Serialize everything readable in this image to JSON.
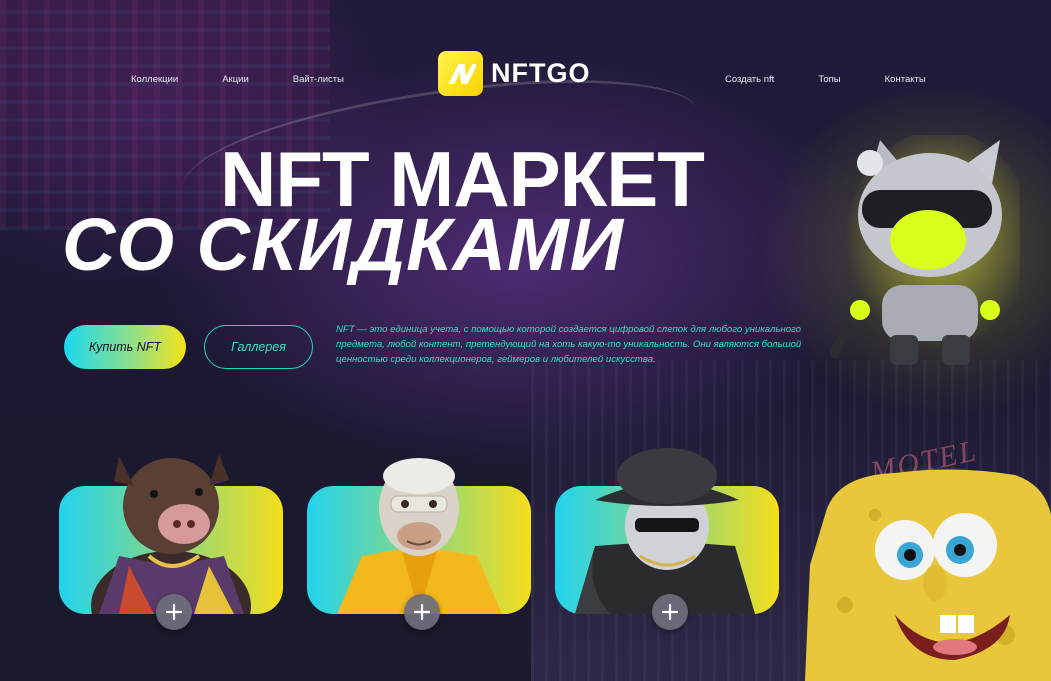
{
  "nav": {
    "left": [
      "Коллекции",
      "Акции",
      "Вайт-листы"
    ],
    "right": [
      "Создать nft",
      "Топы",
      "Контакты"
    ]
  },
  "logo": {
    "text": "NFTGO"
  },
  "hero": {
    "line1": "NFT МАРКЕТ",
    "line2": "СО СКИДКАМИ",
    "buy_label": "Купить NFT",
    "gallery_label": "Галлерея",
    "description": "NFT — это единица учета, с помощью которой создается цифровой слепок для любого уникального предмета, любой контент, претендующий на хоть какую-то уникальность. Они являются большой ценностью среди коллекционеров, геймеров и любителей искусства."
  },
  "decor": {
    "neon_sign": "MOTEL"
  },
  "cards": [
    {
      "art": "boar-character",
      "action": "add"
    },
    {
      "art": "ape-character",
      "action": "add"
    },
    {
      "art": "masked-bucket-hat-character",
      "action": "add"
    }
  ],
  "colors": {
    "accent_cyan": "#22d3ee",
    "accent_yellow": "#f5de1c",
    "accent_teal_text": "#2fe3c4",
    "logo_yellow": "#f7d400"
  },
  "icons": {
    "card_action": "plus-icon",
    "logo": "nftgo-n-icon"
  }
}
